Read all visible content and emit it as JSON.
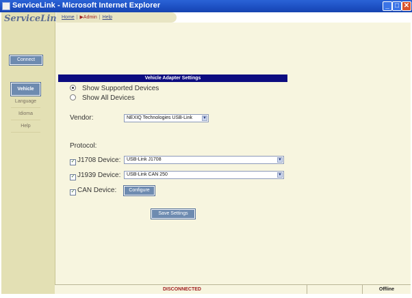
{
  "window": {
    "title": "ServiceLink - Microsoft Internet Explorer"
  },
  "app": {
    "logo": "ServiceLink"
  },
  "nav": {
    "home": "Home",
    "admin": "Admin",
    "help": "Help"
  },
  "sidebar": {
    "connect": "Connect",
    "items": [
      {
        "label": "Vehicle",
        "active": true
      },
      {
        "label": "Language"
      },
      {
        "label": "Idioma"
      },
      {
        "label": "Help"
      }
    ]
  },
  "panel": {
    "title": "Vehicle Adapter Settings",
    "show_supported": "Show Supported Devices",
    "show_all": "Show All Devices",
    "vendor_label": "Vendor:",
    "vendor_value": "NEXIQ Technologies USB-Link",
    "protocol_label": "Protocol:",
    "j1708_label": "J1708 Device:",
    "j1708_value": "USB-Link J1708",
    "j1939_label": "J1939 Device:",
    "j1939_value": "USB-Link CAN 250",
    "can_label": "CAN Device:",
    "configure": "Configure",
    "save": "Save Settings"
  },
  "status": {
    "connection": "DISCONNECTED",
    "mode": "Offline"
  }
}
